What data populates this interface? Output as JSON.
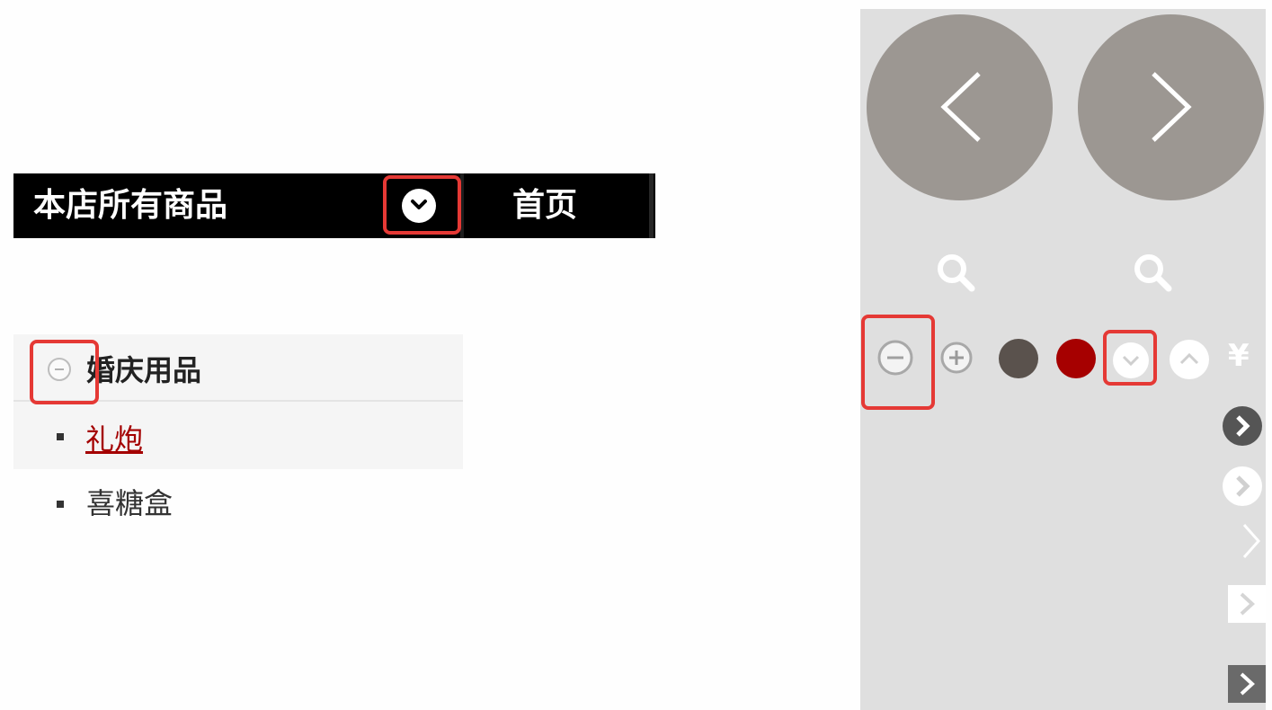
{
  "navbar": {
    "title": "本店所有商品",
    "home_label": "首页",
    "dropdown_icon": "chevron-down-circle-icon"
  },
  "category": {
    "label": "婚庆用品",
    "items": [
      {
        "label": "礼炮",
        "active": true
      },
      {
        "label": "喜糖盒",
        "active": false
      }
    ]
  },
  "sprite": {
    "yen_symbol": "¥",
    "icons": [
      "arrow-left-circle-icon",
      "arrow-right-circle-icon",
      "search-icon",
      "search-icon",
      "minus-circle-icon",
      "plus-circle-icon",
      "dark-dot-icon",
      "red-dot-icon",
      "chevron-down-circle-icon",
      "chevron-up-circle-icon",
      "yen-icon",
      "chevron-right-circle-icon",
      "chevron-right-icon",
      "chevron-right-square-icon"
    ]
  },
  "colors": {
    "nav_bg": "#000000",
    "highlight": "#e53935",
    "active_link": "#a40000",
    "sprite_bg": "#dfdfdf",
    "circle_gray": "#9c9792",
    "dark_dot": "#5a524d",
    "red_dot": "#a60000"
  }
}
